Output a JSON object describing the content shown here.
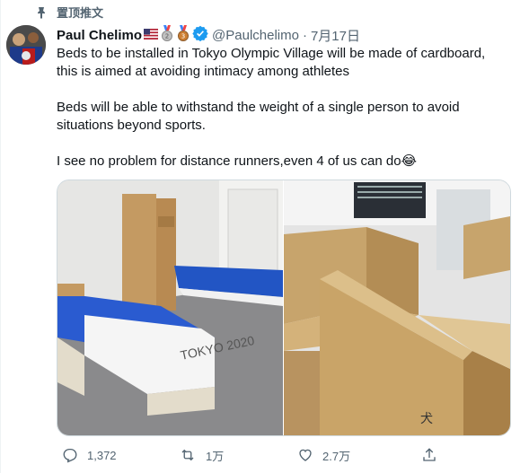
{
  "pinned": {
    "label": "置顶推文",
    "icon": "pin-icon"
  },
  "author": {
    "name": "Paul Chelimo",
    "badges": [
      "us-flag-icon",
      "silver-medal-icon",
      "bronze-medal-icon",
      "verified-icon"
    ],
    "handle": "@Paulchelimo",
    "separator": "·",
    "date": "7月17日"
  },
  "tweet": {
    "paragraphs": [
      "Beds to be installed in Tokyo Olympic Village will be made of cardboard, this is aimed at avoiding intimacy among athletes",
      "Beds will be able to withstand the weight of a single person to avoid situations beyond sports.",
      "I see no problem for distance runners,even 4 of us can do😂"
    ]
  },
  "media": {
    "left_photo": {
      "subject": "olympic-bed-photo",
      "bed_label": "TOKYO 2020"
    },
    "right_photo": {
      "subject": "cardboard-bed-frame-photo"
    }
  },
  "actions": {
    "reply_count": "1,372",
    "retweet_count": "1万",
    "like_count": "2.7万"
  },
  "colors": {
    "secondary_text": "#536471",
    "verified": "#1d9bf0",
    "border": "#cfd9de"
  }
}
